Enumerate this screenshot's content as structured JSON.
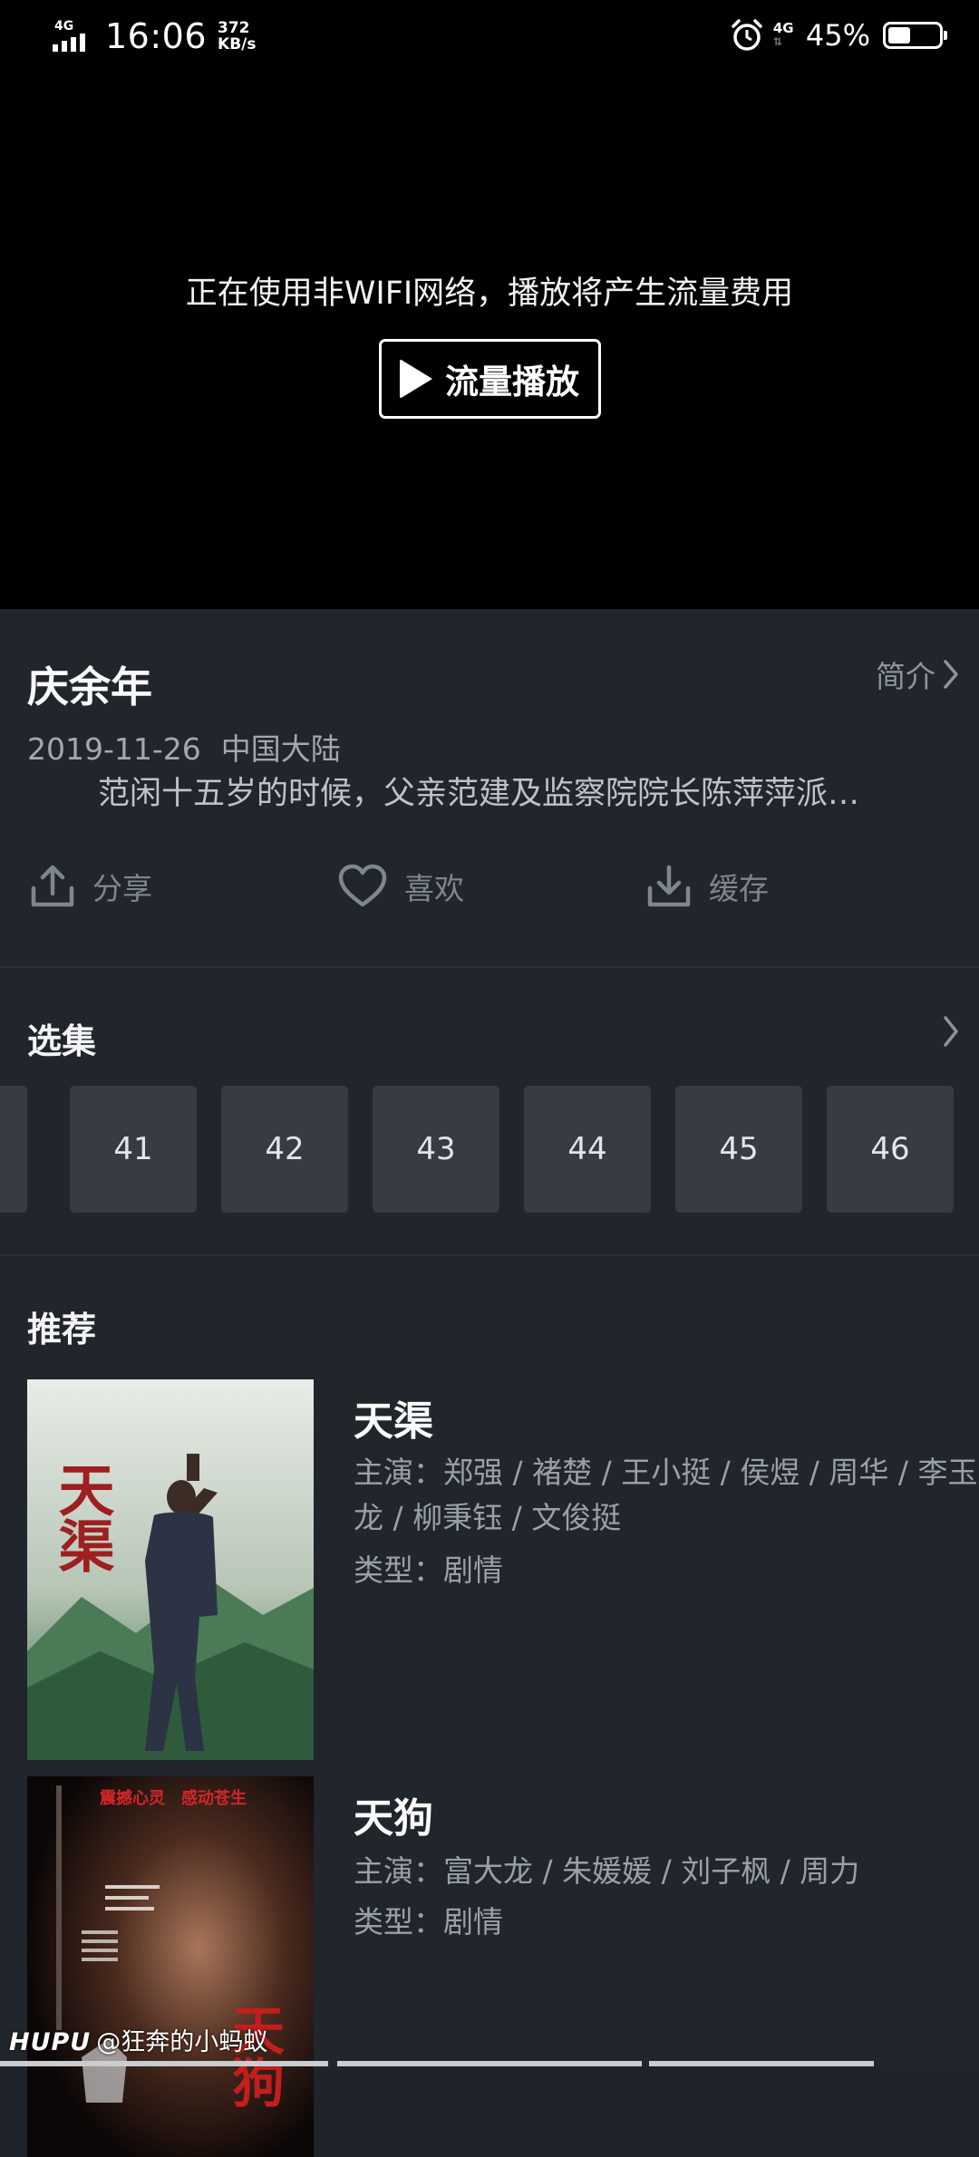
{
  "status_bar": {
    "signal_label": "4G",
    "time": "16:06",
    "speed_value": "372",
    "speed_unit": "KB/s",
    "network": "4G",
    "battery": "45%",
    "battery_level": 0.45
  },
  "player": {
    "message": "正在使用非WIFI网络，播放将产生流量费用",
    "play_label": "流量播放"
  },
  "info": {
    "title": "庆余年",
    "intro_label": "简介",
    "date": "2019-11-26",
    "region": "中国大陆",
    "description": "范闲十五岁的时候，父亲范建及监察院院长陈萍萍派…"
  },
  "actions": {
    "share": "分享",
    "like": "喜欢",
    "cache": "缓存"
  },
  "episodes": {
    "title": "选集",
    "items": [
      "41",
      "42",
      "43",
      "44",
      "45",
      "46"
    ]
  },
  "recommend": {
    "title": "推荐",
    "items": [
      {
        "title": "天渠",
        "cast_label": "主演：",
        "cast": "郑强 / 褚楚 / 王小挺 / 侯煜 / 周华 / 李玉龙 / 柳秉钰 / 文俊挺",
        "genre_label": "类型：",
        "genre": "剧情",
        "poster_text": "天渠"
      },
      {
        "title": "天狗",
        "cast_label": "主演：",
        "cast": "富大龙 / 朱媛媛 / 刘子枫 / 周力",
        "genre_label": "类型：",
        "genre": "剧情",
        "poster_text": "天狗",
        "poster_tagline": "震撼心灵　感动苍生"
      }
    ]
  },
  "watermark": {
    "brand": "HUPU",
    "user": "@狂奔的小蚂蚁"
  },
  "colors": {
    "background": "#1f232a",
    "player_bg": "#000000",
    "episode_tile": "#363b44",
    "muted_text": "#9aa0a8"
  }
}
